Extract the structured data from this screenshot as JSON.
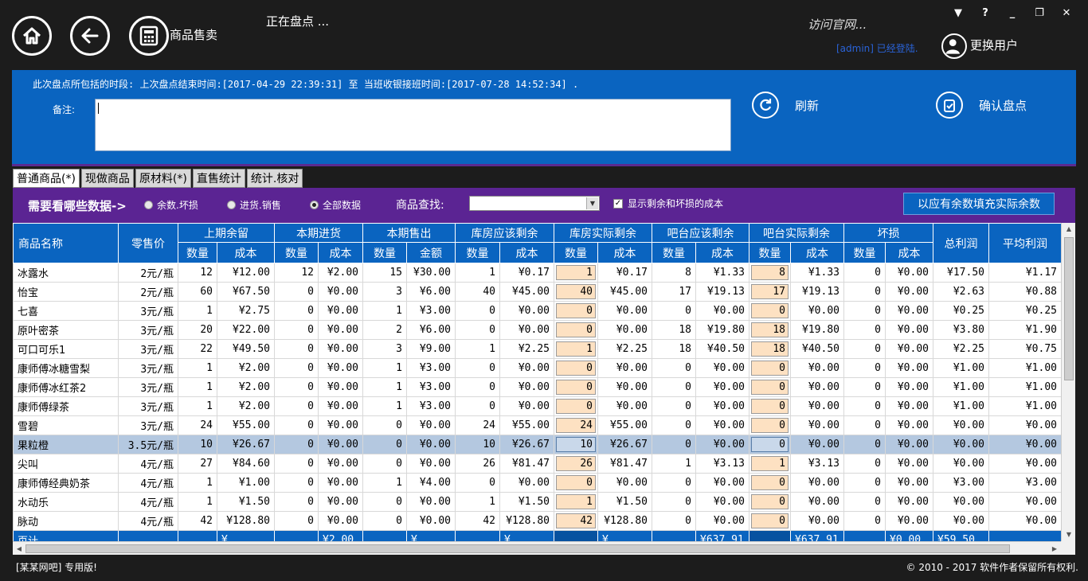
{
  "header": {
    "sale_label": "商品售卖",
    "status": "正在盘点 ...",
    "visit_link": "访问官网...",
    "user_name": "[admin] 已经登陆.",
    "switch_user": "更换用户",
    "window_controls": [
      "▼",
      "?",
      "_",
      "❐",
      "✕"
    ]
  },
  "panel": {
    "period_text": "此次盘点所包括的时段: 上次盘点结束时间:[2017-04-29 22:39:31] 至 当班收银接班时间:[2017-07-28 14:52:34] .",
    "note_label": "备注:",
    "note_value": "",
    "refresh_label": "刷新",
    "confirm_label": "确认盘点"
  },
  "tabs": [
    "普通商品(*)",
    "现做商品",
    "原材料(*)",
    "直售统计",
    "统计.核对"
  ],
  "filter": {
    "prompt": "需要看哪些数据->",
    "options": [
      "余数.坏损",
      "进货.销售",
      "全部数据"
    ],
    "selected_index": 2,
    "search_label": "商品查找:",
    "search_value": "",
    "checkbox_label": "显示剩余和坏损的成本",
    "checkbox_checked": true,
    "fill_button": "以应有余数填充实际余数"
  },
  "table": {
    "group_headers": [
      "商品名称",
      "零售价",
      "上期余留",
      "本期进货",
      "本期售出",
      "库房应该剩余",
      "库房实际剩余",
      "吧台应该剩余",
      "吧台实际剩余",
      "坏损",
      "总利润",
      "平均利润"
    ],
    "sub_headers": [
      "数量",
      "成本",
      "数量",
      "成本",
      "数量",
      "金额",
      "数量",
      "成本",
      "数量",
      "成本",
      "数量",
      "成本",
      "数量",
      "成本",
      "数量",
      "成本"
    ],
    "rows": [
      [
        "冰露水",
        "2元/瓶",
        "12",
        "¥12.00",
        "12",
        "¥2.00",
        "15",
        "¥30.00",
        "1",
        "¥0.17",
        "1",
        "¥0.17",
        "8",
        "¥1.33",
        "8",
        "¥1.33",
        "0",
        "¥0.00",
        "¥17.50",
        "¥1.17"
      ],
      [
        "怡宝",
        "2元/瓶",
        "60",
        "¥67.50",
        "0",
        "¥0.00",
        "3",
        "¥6.00",
        "40",
        "¥45.00",
        "40",
        "¥45.00",
        "17",
        "¥19.13",
        "17",
        "¥19.13",
        "0",
        "¥0.00",
        "¥2.63",
        "¥0.88"
      ],
      [
        "七喜",
        "3元/瓶",
        "1",
        "¥2.75",
        "0",
        "¥0.00",
        "1",
        "¥3.00",
        "0",
        "¥0.00",
        "0",
        "¥0.00",
        "0",
        "¥0.00",
        "0",
        "¥0.00",
        "0",
        "¥0.00",
        "¥0.25",
        "¥0.25"
      ],
      [
        "原叶密茶",
        "3元/瓶",
        "20",
        "¥22.00",
        "0",
        "¥0.00",
        "2",
        "¥6.00",
        "0",
        "¥0.00",
        "0",
        "¥0.00",
        "18",
        "¥19.80",
        "18",
        "¥19.80",
        "0",
        "¥0.00",
        "¥3.80",
        "¥1.90"
      ],
      [
        "可口可乐1",
        "3元/瓶",
        "22",
        "¥49.50",
        "0",
        "¥0.00",
        "3",
        "¥9.00",
        "1",
        "¥2.25",
        "1",
        "¥2.25",
        "18",
        "¥40.50",
        "18",
        "¥40.50",
        "0",
        "¥0.00",
        "¥2.25",
        "¥0.75"
      ],
      [
        "康师傅冰糖雪梨",
        "3元/瓶",
        "1",
        "¥2.00",
        "0",
        "¥0.00",
        "1",
        "¥3.00",
        "0",
        "¥0.00",
        "0",
        "¥0.00",
        "0",
        "¥0.00",
        "0",
        "¥0.00",
        "0",
        "¥0.00",
        "¥1.00",
        "¥1.00"
      ],
      [
        "康师傅冰红茶2",
        "3元/瓶",
        "1",
        "¥2.00",
        "0",
        "¥0.00",
        "1",
        "¥3.00",
        "0",
        "¥0.00",
        "0",
        "¥0.00",
        "0",
        "¥0.00",
        "0",
        "¥0.00",
        "0",
        "¥0.00",
        "¥1.00",
        "¥1.00"
      ],
      [
        "康师傅绿茶",
        "3元/瓶",
        "1",
        "¥2.00",
        "0",
        "¥0.00",
        "1",
        "¥3.00",
        "0",
        "¥0.00",
        "0",
        "¥0.00",
        "0",
        "¥0.00",
        "0",
        "¥0.00",
        "0",
        "¥0.00",
        "¥1.00",
        "¥1.00"
      ],
      [
        "雪碧",
        "3元/瓶",
        "24",
        "¥55.00",
        "0",
        "¥0.00",
        "0",
        "¥0.00",
        "24",
        "¥55.00",
        "24",
        "¥55.00",
        "0",
        "¥0.00",
        "0",
        "¥0.00",
        "0",
        "¥0.00",
        "¥0.00",
        "¥0.00"
      ],
      [
        "果粒橙",
        "3.5元/瓶",
        "10",
        "¥26.67",
        "0",
        "¥0.00",
        "0",
        "¥0.00",
        "10",
        "¥26.67",
        "10",
        "¥26.67",
        "0",
        "¥0.00",
        "0",
        "¥0.00",
        "0",
        "¥0.00",
        "¥0.00",
        "¥0.00"
      ],
      [
        "尖叫",
        "4元/瓶",
        "27",
        "¥84.60",
        "0",
        "¥0.00",
        "0",
        "¥0.00",
        "26",
        "¥81.47",
        "26",
        "¥81.47",
        "1",
        "¥3.13",
        "1",
        "¥3.13",
        "0",
        "¥0.00",
        "¥0.00",
        "¥0.00"
      ],
      [
        "康师傅经典奶茶",
        "4元/瓶",
        "1",
        "¥1.00",
        "0",
        "¥0.00",
        "1",
        "¥4.00",
        "0",
        "¥0.00",
        "0",
        "¥0.00",
        "0",
        "¥0.00",
        "0",
        "¥0.00",
        "0",
        "¥0.00",
        "¥3.00",
        "¥3.00"
      ],
      [
        "水动乐",
        "4元/瓶",
        "1",
        "¥1.50",
        "0",
        "¥0.00",
        "0",
        "¥0.00",
        "1",
        "¥1.50",
        "1",
        "¥1.50",
        "0",
        "¥0.00",
        "0",
        "¥0.00",
        "0",
        "¥0.00",
        "¥0.00",
        "¥0.00"
      ],
      [
        "脉动",
        "4元/瓶",
        "42",
        "¥128.80",
        "0",
        "¥0.00",
        "0",
        "¥0.00",
        "42",
        "¥128.80",
        "42",
        "¥128.80",
        "0",
        "¥0.00",
        "0",
        "¥0.00",
        "0",
        "¥0.00",
        "¥0.00",
        "¥0.00"
      ]
    ],
    "selected_row": 9,
    "totals": [
      "页计",
      "",
      "",
      "¥",
      "",
      "¥2.00",
      "",
      "¥",
      "",
      "¥",
      "",
      "¥",
      "",
      "¥637.91",
      "",
      "¥637.91",
      "",
      "¥0.00",
      "¥59.50",
      ""
    ]
  },
  "statusbar": {
    "left": "[某某网吧] 专用版!",
    "right": "© 2010 - 2017 软件作者保留所有权利."
  }
}
